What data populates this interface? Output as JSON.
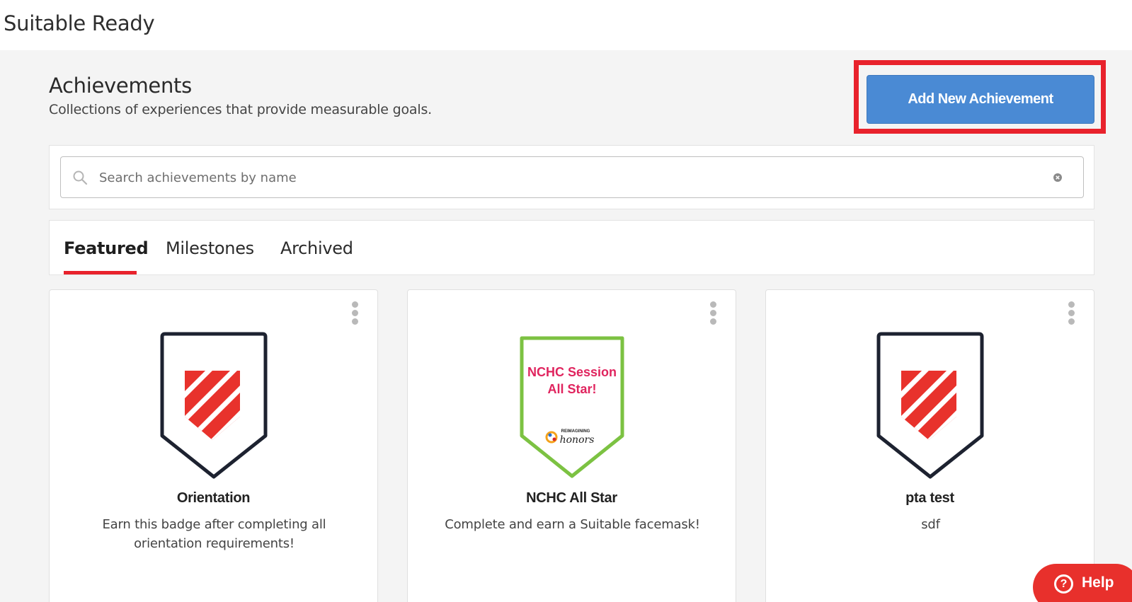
{
  "app": {
    "title": "Suitable Ready"
  },
  "header": {
    "title": "Achievements",
    "subtitle": "Collections of experiences that provide measurable goals.",
    "add_button_label": "Add New Achievement"
  },
  "search": {
    "placeholder": "Search achievements by name",
    "value": ""
  },
  "tabs": [
    {
      "label": "Featured",
      "active": true
    },
    {
      "label": "Milestones",
      "active": false
    },
    {
      "label": "Archived",
      "active": false
    }
  ],
  "cards": [
    {
      "title": "Orientation",
      "description": "Earn this badge after completing all orientation requirements!",
      "badge_icon": "shield-badge-icon"
    },
    {
      "title": "NCHC All Star",
      "description": "Complete and earn a Suitable facemask!",
      "badge_icon": "nchc-badge-icon",
      "badge_text": "NCHC Session All Star!",
      "badge_logo_text_top": "REIMAGINING",
      "badge_logo_text": "honors"
    },
    {
      "title": "pta test",
      "description": "sdf",
      "badge_icon": "shield-badge-icon"
    }
  ],
  "help": {
    "label": "Help",
    "icon": "?"
  },
  "colors": {
    "accent": "#e8222c",
    "primary": "#4a8ad4",
    "badge_outline": "#1d2230",
    "badge_green": "#7cc242",
    "badge_pink": "#e0245e"
  }
}
